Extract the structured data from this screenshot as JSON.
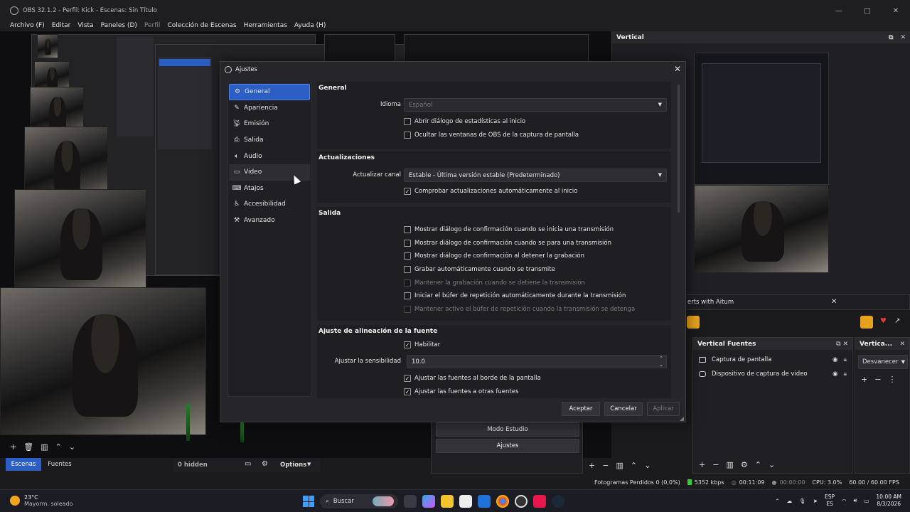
{
  "window": {
    "title": "OBS 32.1.2 - Perfil: Kick - Escenas: Sin Título",
    "controls": [
      "—",
      "□",
      "✕"
    ]
  },
  "menu": [
    "Archivo (F)",
    "Editar",
    "Vista",
    "Paneles (D)",
    "Perfil",
    "Colección de Escenas",
    "Herramientas",
    "Ayuda (H)"
  ],
  "vertical_panel": {
    "title": "Vertical"
  },
  "vertical_sources": {
    "title": "Vertical Fuentes",
    "items": [
      {
        "label": "Captura de pantalla",
        "icon": "monitor-icon"
      },
      {
        "label": "Dispositivo de captura de video",
        "icon": "camera-icon"
      }
    ]
  },
  "vertical_transitions": {
    "title": "Vertica...",
    "selected": "Desvanecer"
  },
  "dock_tab_text": "erts with Aitum",
  "left_dock": {
    "tab_scenes": "Escenas",
    "tab_sources": "Fuentes",
    "hidden_label": "0 hidden",
    "options_label": "Options"
  },
  "controls_dock": {
    "studio_mode": "Modo Estudio",
    "settings": "Ajustes"
  },
  "status_bar": {
    "dropped_frames": "Fotogramas Perdidos 0 (0,0%)",
    "bitrate": "5352 kbps",
    "stream_time": "00:11:09",
    "rec_time": "00:00:00",
    "cpu": "CPU: 3.0%",
    "fps": "60.00 / 60.00 FPS"
  },
  "dialog": {
    "title": "Ajustes",
    "sidebar": [
      {
        "label": "General",
        "icon": "gear-icon",
        "selected": true
      },
      {
        "label": "Apariencia",
        "icon": "palette-icon"
      },
      {
        "label": "Emisión",
        "icon": "broadcast-icon"
      },
      {
        "label": "Salida",
        "icon": "output-icon"
      },
      {
        "label": "Audio",
        "icon": "speaker-icon"
      },
      {
        "label": "Video",
        "icon": "monitor-icon",
        "hover": true
      },
      {
        "label": "Atajos",
        "icon": "keyboard-icon"
      },
      {
        "label": "Accesibilidad",
        "icon": "accessibility-icon"
      },
      {
        "label": "Avanzado",
        "icon": "wrench-icon"
      }
    ],
    "general": {
      "title": "General",
      "language_label": "Idioma",
      "language_value": "Español",
      "checkboxes": [
        {
          "label": "Abrir diálogo de estadísticas al inicio",
          "checked": false
        },
        {
          "label": "Ocultar las ventanas de OBS de la captura de pantalla",
          "checked": false
        }
      ]
    },
    "updates": {
      "title": "Actualizaciones",
      "channel_label": "Actualizar canal",
      "channel_value": "Estable - Última versión estable (Predeterminado)",
      "auto_check": {
        "label": "Comprobar actualizaciones automáticamente al inicio",
        "checked": true
      }
    },
    "output": {
      "title": "Salida",
      "checkboxes": [
        {
          "label": "Mostrar diálogo de confirmación cuando se inicia una transmisión",
          "checked": false,
          "disabled": false
        },
        {
          "label": "Mostrar diálogo de confirmación cuando se para una transmisión",
          "checked": false,
          "disabled": false
        },
        {
          "label": "Mostrar diálogo de confirmación al detener la grabación",
          "checked": false,
          "disabled": false
        },
        {
          "label": "Grabar automáticamente cuando se transmite",
          "checked": false,
          "disabled": false
        },
        {
          "label": "Mantener la grabación cuando se detiene la transmisión",
          "checked": false,
          "disabled": true
        },
        {
          "label": "Iniciar el búfer de repetición automáticamente durante la transmisión",
          "checked": false,
          "disabled": false
        },
        {
          "label": "Mantener activo el búfer de repetición cuando la transmisión se detenga",
          "checked": false,
          "disabled": true
        }
      ]
    },
    "snapping": {
      "title": "Ajuste de alineación de la fuente",
      "enable": {
        "label": "Habilitar",
        "checked": true
      },
      "sensitivity_label": "Ajustar la sensibilidad",
      "sensitivity_value": "10.0",
      "checkboxes": [
        {
          "label": "Ajustar las fuentes al borde de la pantalla",
          "checked": true
        },
        {
          "label": "Ajustar las fuentes a otras fuentes",
          "checked": true
        }
      ]
    },
    "buttons": {
      "ok": "Aceptar",
      "cancel": "Cancelar",
      "apply": "Aplicar"
    }
  },
  "taskbar": {
    "weather_temp": "23°C",
    "weather_desc": "Mayorm. soleado",
    "search": "Buscar",
    "lang_top": "ESP",
    "lang_bottom": "ES",
    "time": "10:00 AM",
    "date": "8/3/2026"
  },
  "colors": {
    "accent": "#2c5fc5",
    "background": "#1b1b1e",
    "dialog": "#25252a"
  }
}
